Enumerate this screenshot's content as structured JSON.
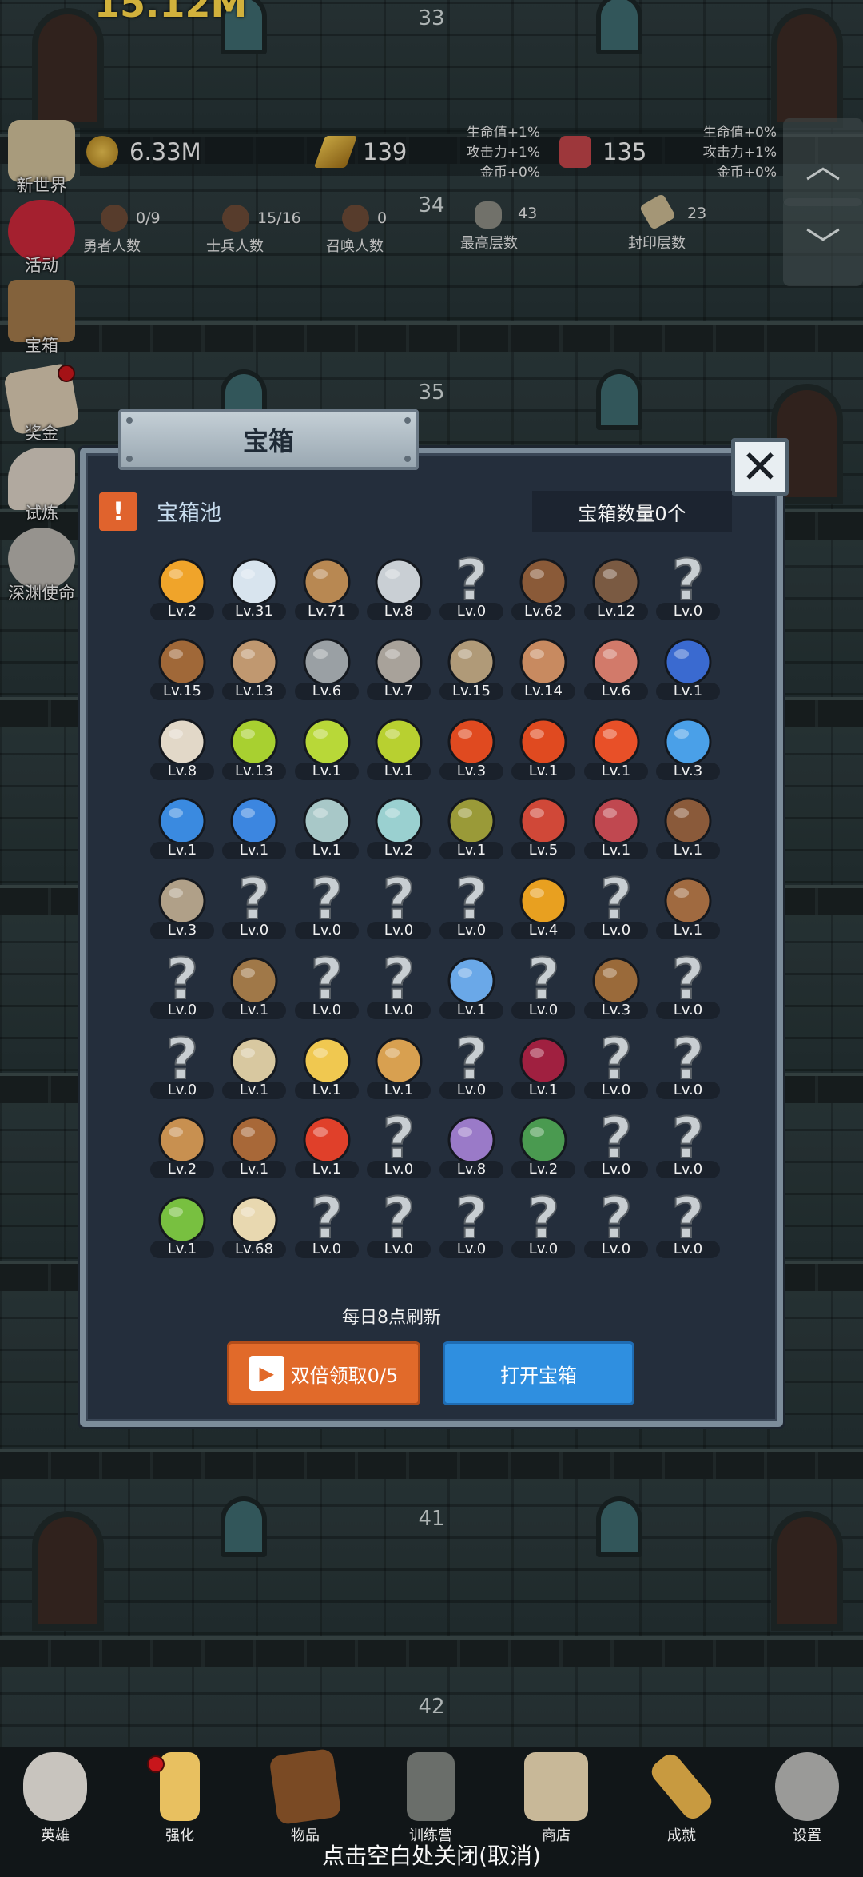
{
  "top_clipped_text": "15.12M",
  "floors": [
    "33",
    "34",
    "35",
    "41",
    "42"
  ],
  "resources": {
    "gold": "6.33M",
    "gold_bar": "139",
    "meat": "135"
  },
  "bonus_left": [
    "生命值+1%",
    "攻击力+1%",
    "金币+0%"
  ],
  "bonus_right": [
    "生命值+0%",
    "攻击力+1%",
    "金币+0%"
  ],
  "stats": [
    {
      "value": "0/9",
      "label": "勇者人数"
    },
    {
      "value": "15/16",
      "label": "士兵人数"
    },
    {
      "value": "0",
      "label": "召唤人数"
    },
    {
      "value": "43",
      "label": "最高层数"
    },
    {
      "value": "23",
      "label": "封印层数"
    }
  ],
  "left_menu": [
    "新世界",
    "活动",
    "宝箱",
    "奖金",
    "试炼",
    "深渊使命"
  ],
  "scroll": {
    "up": "︿",
    "down": "﹀"
  },
  "dialog": {
    "title": "宝箱",
    "close": "✕",
    "alert_icon": "!",
    "pool_label": "宝箱池",
    "count_label": "宝箱数量0个",
    "refresh_text": "每日8点刷新",
    "double_button": "双倍领取0/5",
    "open_button": "打开宝箱"
  },
  "items": [
    {
      "icon": "crown",
      "level": "Lv.2",
      "color": "#f0a42a"
    },
    {
      "icon": "diamond",
      "level": "Lv.31",
      "color": "#d8e4ee"
    },
    {
      "icon": "wooden-sword",
      "level": "Lv.71",
      "color": "#b88852"
    },
    {
      "icon": "iron-sword",
      "level": "Lv.8",
      "color": "#c9cfd4"
    },
    {
      "icon": "unknown",
      "level": "Lv.0",
      "color": "#c8ced2"
    },
    {
      "icon": "leather-armor",
      "level": "Lv.62",
      "color": "#8a5a38"
    },
    {
      "icon": "backpack-armor",
      "level": "Lv.12",
      "color": "#7a5a42"
    },
    {
      "icon": "unknown",
      "level": "Lv.0",
      "color": "#c8ced2"
    },
    {
      "icon": "leather-helmet",
      "level": "Lv.15",
      "color": "#a06838"
    },
    {
      "icon": "dagger",
      "level": "Lv.13",
      "color": "#c09870"
    },
    {
      "icon": "knight-helmet",
      "level": "Lv.6",
      "color": "#9aa0a4"
    },
    {
      "icon": "hammer",
      "level": "Lv.7",
      "color": "#a8a29a"
    },
    {
      "icon": "bucket-helmet",
      "level": "Lv.15",
      "color": "#b09a78"
    },
    {
      "icon": "ham",
      "level": "Lv.14",
      "color": "#c88a60"
    },
    {
      "icon": "steak",
      "level": "Lv.6",
      "color": "#d27a6a"
    },
    {
      "icon": "blue-pouch",
      "level": "Lv.1",
      "color": "#3a6ad0"
    },
    {
      "icon": "bread",
      "level": "Lv.8",
      "color": "#e2d8c8"
    },
    {
      "icon": "green-potion",
      "level": "Lv.13",
      "color": "#a8d030"
    },
    {
      "icon": "green-potion",
      "level": "Lv.1",
      "color": "#b8d838"
    },
    {
      "icon": "green-potion",
      "level": "Lv.1",
      "color": "#b8d030"
    },
    {
      "icon": "red-potion",
      "level": "Lv.3",
      "color": "#e04a20"
    },
    {
      "icon": "red-potion",
      "level": "Lv.1",
      "color": "#e04a20"
    },
    {
      "icon": "red-potion",
      "level": "Lv.1",
      "color": "#e85028"
    },
    {
      "icon": "blue-potion",
      "level": "Lv.3",
      "color": "#4aa0e8"
    },
    {
      "icon": "blue-potion",
      "level": "Lv.1",
      "color": "#3a8ae0"
    },
    {
      "icon": "blue-potion",
      "level": "Lv.1",
      "color": "#3c86e0"
    },
    {
      "icon": "glass-bottle",
      "level": "Lv.1",
      "color": "#a8c8c8"
    },
    {
      "icon": "glass-bottle",
      "level": "Lv.2",
      "color": "#9ad0d0"
    },
    {
      "icon": "olive-bottle",
      "level": "Lv.1",
      "color": "#9a9a38"
    },
    {
      "icon": "red-bottle",
      "level": "Lv.5",
      "color": "#d04838"
    },
    {
      "icon": "winged-boot",
      "level": "Lv.1",
      "color": "#c04850"
    },
    {
      "icon": "leather-boot",
      "level": "Lv.1",
      "color": "#8a5a3a"
    },
    {
      "icon": "shoe",
      "level": "Lv.3",
      "color": "#b0a088"
    },
    {
      "icon": "unknown",
      "level": "Lv.0",
      "color": "#c8ced2"
    },
    {
      "icon": "unknown",
      "level": "Lv.0",
      "color": "#c8ced2"
    },
    {
      "icon": "unknown",
      "level": "Lv.0",
      "color": "#c8ced2"
    },
    {
      "icon": "unknown",
      "level": "Lv.0",
      "color": "#c8ced2"
    },
    {
      "icon": "torch",
      "level": "Lv.4",
      "color": "#e8a020"
    },
    {
      "icon": "unknown",
      "level": "Lv.0",
      "color": "#c8ced2"
    },
    {
      "icon": "mushroom",
      "level": "Lv.1",
      "color": "#a06a40"
    },
    {
      "icon": "unknown",
      "level": "Lv.0",
      "color": "#c8ced2"
    },
    {
      "icon": "wooden-staff",
      "level": "Lv.1",
      "color": "#a07848"
    },
    {
      "icon": "unknown",
      "level": "Lv.0",
      "color": "#c8ced2"
    },
    {
      "icon": "unknown",
      "level": "Lv.0",
      "color": "#c8ced2"
    },
    {
      "icon": "blue-orb-staff",
      "level": "Lv.1",
      "color": "#6aa8e8"
    },
    {
      "icon": "unknown",
      "level": "Lv.0",
      "color": "#c8ced2"
    },
    {
      "icon": "leather-bag",
      "level": "Lv.3",
      "color": "#9a6a3a"
    },
    {
      "icon": "unknown",
      "level": "Lv.0",
      "color": "#c8ced2"
    },
    {
      "icon": "unknown",
      "level": "Lv.0",
      "color": "#c8ced2"
    },
    {
      "icon": "bone-club",
      "level": "Lv.1",
      "color": "#d8c8a0"
    },
    {
      "icon": "cheese",
      "level": "Lv.1",
      "color": "#f0c850"
    },
    {
      "icon": "pie",
      "level": "Lv.1",
      "color": "#d8a050"
    },
    {
      "icon": "unknown",
      "level": "Lv.0",
      "color": "#c8ced2"
    },
    {
      "icon": "red-crystal",
      "level": "Lv.1",
      "color": "#a02040"
    },
    {
      "icon": "unknown",
      "level": "Lv.0",
      "color": "#c8ced2"
    },
    {
      "icon": "unknown",
      "level": "Lv.0",
      "color": "#c8ced2"
    },
    {
      "icon": "bow",
      "level": "Lv.2",
      "color": "#c89050"
    },
    {
      "icon": "quiver",
      "level": "Lv.1",
      "color": "#a86838"
    },
    {
      "icon": "fire-glove",
      "level": "Lv.1",
      "color": "#e0402a"
    },
    {
      "icon": "unknown",
      "level": "Lv.0",
      "color": "#c8ced2"
    },
    {
      "icon": "tentacle-relic",
      "level": "Lv.8",
      "color": "#9a7ac8"
    },
    {
      "icon": "green-shield",
      "level": "Lv.2",
      "color": "#4a9a50"
    },
    {
      "icon": "unknown",
      "level": "Lv.0",
      "color": "#c8ced2"
    },
    {
      "icon": "unknown",
      "level": "Lv.0",
      "color": "#c8ced2"
    },
    {
      "icon": "green-orb-wand",
      "level": "Lv.1",
      "color": "#78c040"
    },
    {
      "icon": "beer-mug",
      "level": "Lv.68",
      "color": "#e8d8b0"
    },
    {
      "icon": "unknown",
      "level": "Lv.0",
      "color": "#c8ced2"
    },
    {
      "icon": "unknown",
      "level": "Lv.0",
      "color": "#c8ced2"
    },
    {
      "icon": "unknown",
      "level": "Lv.0",
      "color": "#c8ced2"
    },
    {
      "icon": "unknown",
      "level": "Lv.0",
      "color": "#c8ced2"
    },
    {
      "icon": "unknown",
      "level": "Lv.0",
      "color": "#c8ced2"
    },
    {
      "icon": "unknown",
      "level": "Lv.0",
      "color": "#c8ced2"
    }
  ],
  "bottom_nav": [
    "英雄",
    "强化",
    "物品",
    "训练营",
    "商店",
    "成就",
    "设置"
  ],
  "close_hint": "点击空白处关闭(取消)",
  "colors": {
    "panel_bg": "#242e3c",
    "double_button": "#e16a2a",
    "open_button": "#2f8fe0",
    "accent_orange": "#e0632d"
  }
}
